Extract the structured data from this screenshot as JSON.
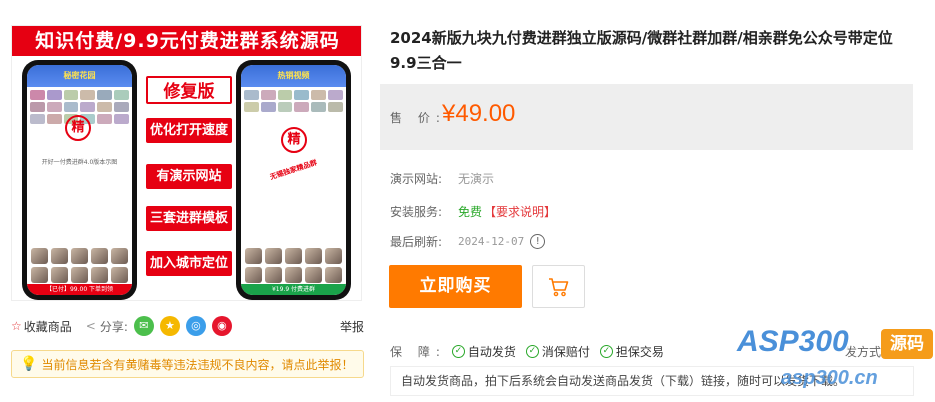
{
  "promo": {
    "banner": "知识付费/9.9元付费进群系统源码",
    "left_screen_header": "秘密花园",
    "right_screen_header": "热销视频",
    "stamp": "精",
    "left_screen_caption": "开好一付费进群4.0版本示图",
    "right_screen_slant": "无锡独家精品群",
    "left_screen_bottom": "【已付】99.00 下单到领",
    "right_screen_bottom": "¥19.9 付费进群",
    "features": [
      "修复版",
      "优化打开速度",
      "有演示网站",
      "三套进群模板",
      "加入城市定位"
    ]
  },
  "share": {
    "favorite": "收藏商品",
    "share_label": "分享:",
    "icons": [
      "wechat-icon",
      "qzone-icon",
      "qq-icon",
      "weibo-icon"
    ],
    "report": "举报"
  },
  "notice": "当前信息若含有黄赌毒等违法违规不良内容，请点此举报！",
  "product": {
    "title": "2024新版九块九付费进群独立版源码/微群社群加群/相亲群免公众号带定位9.9三合一",
    "price_label": "售 价:",
    "price": "¥49.00",
    "demo_label": "演示网站:",
    "demo_value": "无演示",
    "install_label": "安装服务:",
    "install_value": "免费",
    "install_link": "【要求说明】",
    "refresh_label": "最后刷新:",
    "refresh_value": "2024-12-07",
    "buy_button": "立即购买",
    "guarantee_label": "保 障:",
    "guarantees": [
      "自动发货",
      "消保赔付",
      "担保交易"
    ],
    "more": "发方式",
    "delivery_text": "自动发货商品，拍下后系统会自动发送商品发货（下载）链接，随时可以发货下载。"
  },
  "watermark": {
    "main": "ASP300",
    "badge": "源码",
    "sub": "asp300.cn"
  },
  "colors": {
    "brand_red": "#e60012",
    "price_orange": "#ff5a00",
    "buy_orange": "#ff7a00",
    "check_green": "#2aa82a"
  }
}
